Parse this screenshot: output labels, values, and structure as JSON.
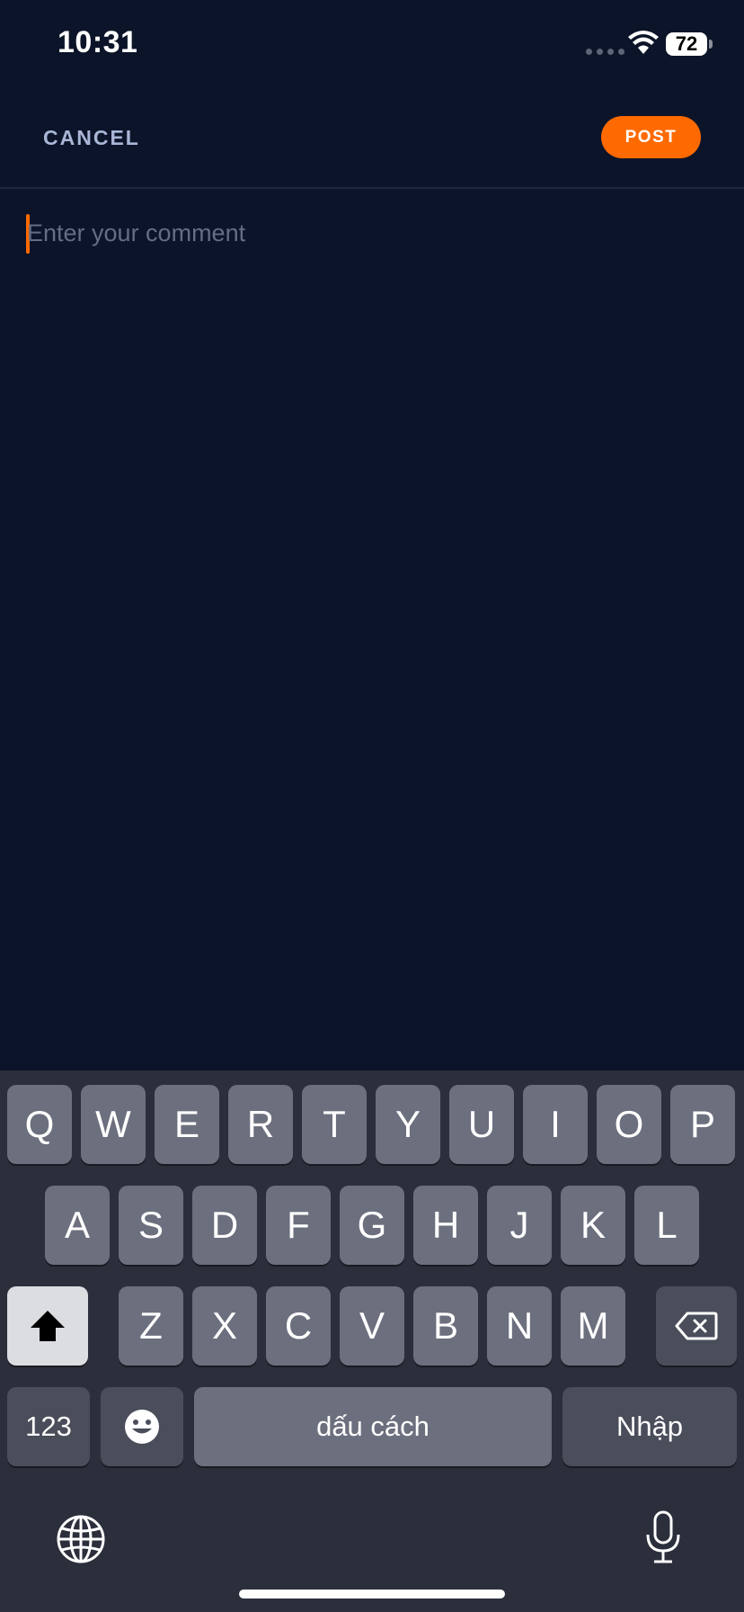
{
  "status": {
    "time": "10:31",
    "battery": "72"
  },
  "nav": {
    "cancel_label": "CANCEL",
    "post_label": "POST"
  },
  "comment": {
    "placeholder": "Enter your comment"
  },
  "keyboard": {
    "row1": [
      "Q",
      "W",
      "E",
      "R",
      "T",
      "Y",
      "U",
      "I",
      "O",
      "P"
    ],
    "row2": [
      "A",
      "S",
      "D",
      "F",
      "G",
      "H",
      "J",
      "K",
      "L"
    ],
    "row3": [
      "Z",
      "X",
      "C",
      "V",
      "B",
      "N",
      "M"
    ],
    "numbers_label": "123",
    "space_label": "dấu cách",
    "return_label": "Nhập"
  },
  "icons": [
    "wifi-icon",
    "battery-icon",
    "shift-icon",
    "backspace-icon",
    "emoji-icon",
    "globe-icon",
    "microphone-icon"
  ],
  "colors": {
    "accent": "#ff6a00",
    "background": "#0c1429",
    "cancel": "#a9b6d6",
    "keyboard": "#2b2e3b"
  }
}
